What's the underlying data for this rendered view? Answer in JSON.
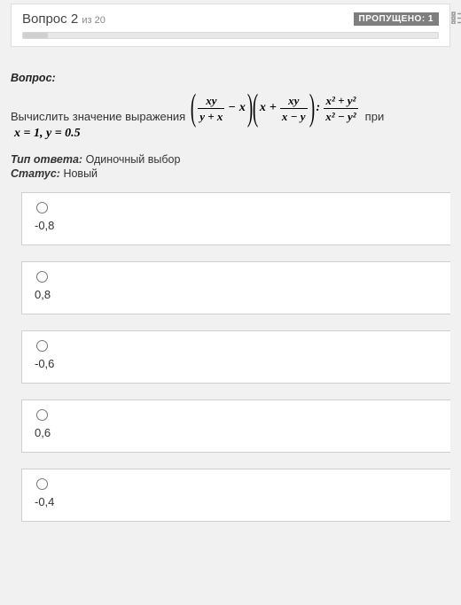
{
  "header": {
    "question_word": "Вопрос",
    "question_number": "2",
    "of_word": "из",
    "total": "20",
    "skipped_badge": "ПРОПУЩЕНО: 1"
  },
  "labels": {
    "question_heading": "Вопрос:",
    "prompt_lead": "Вычислить значение выражения",
    "at_word": "при",
    "answer_type_label": "Тип ответа:",
    "answer_type_value": "Одиночный выбор",
    "status_label": "Статус:",
    "status_value": "Новый"
  },
  "formula": {
    "f1_num": "xy",
    "f1_den": "y + x",
    "minus": "−",
    "x": "x",
    "plus": "+",
    "f2_num": "xy",
    "f2_den": "x − y",
    "colon": ":",
    "f3_num": "x² + y²",
    "f3_den": "x² − y²",
    "given": "x = 1, y = 0.5"
  },
  "options": [
    {
      "text": "-0,8"
    },
    {
      "text": "0,8"
    },
    {
      "text": "-0,6"
    },
    {
      "text": "0,6"
    },
    {
      "text": "-0,4"
    }
  ]
}
